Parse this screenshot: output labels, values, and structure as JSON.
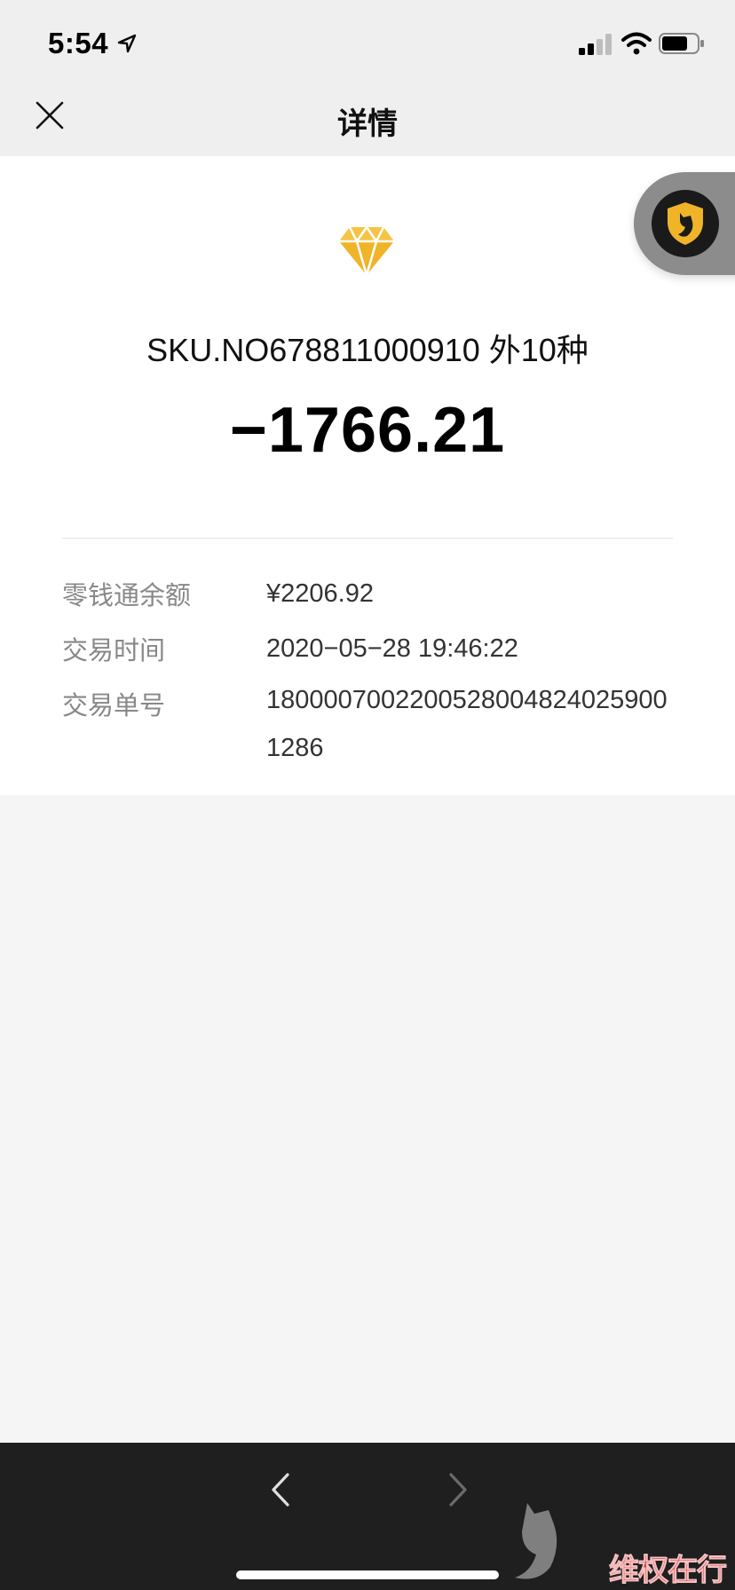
{
  "status_bar": {
    "time": "5:54"
  },
  "nav": {
    "title": "详情"
  },
  "transaction": {
    "merchant": "SKU.NO678811000910 外10种",
    "amount": "−1766.21",
    "rows": [
      {
        "label": "零钱通余额",
        "value": "¥2206.92"
      },
      {
        "label": "交易时间",
        "value": "2020−05−28 19:46:22"
      },
      {
        "label": "交易单号",
        "value": "18000070022005280048240259001286"
      }
    ]
  },
  "watermark": {
    "text": "维权在行动"
  },
  "colors": {
    "diamond": "#f0b429",
    "toolbar": "#1f1f1f",
    "watermark": "#c81e1e"
  },
  "icons": {
    "close": "close-icon",
    "diamond": "diamond-icon",
    "badge": "shield-cat-icon",
    "back": "chevron-left-icon",
    "forward": "chevron-right-icon"
  }
}
